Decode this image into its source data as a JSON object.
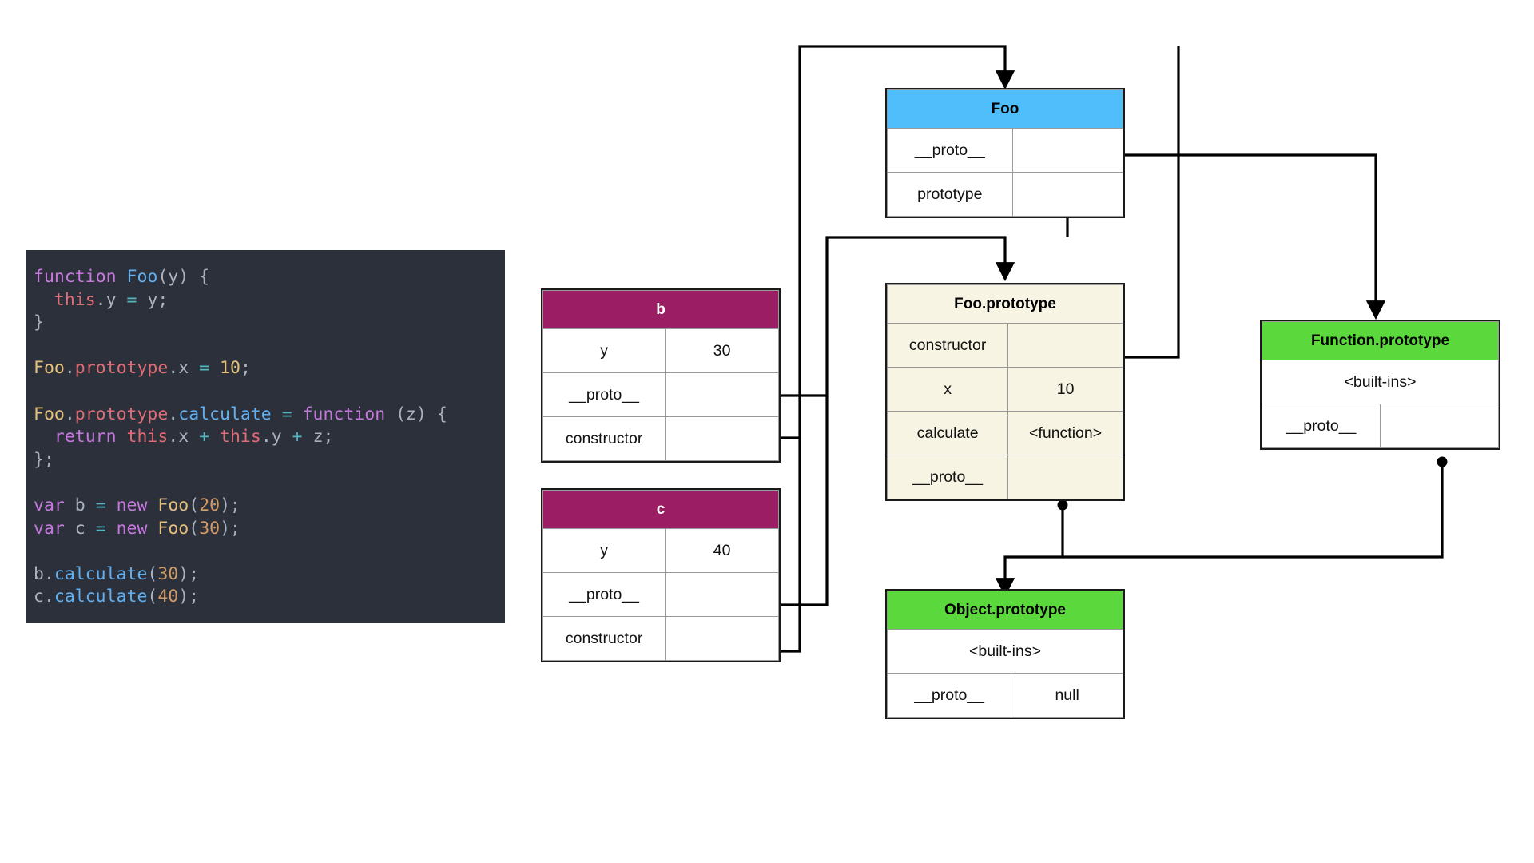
{
  "code": {
    "language": "javascript",
    "lines": [
      [
        {
          "t": "function ",
          "c": "kw"
        },
        {
          "t": "Foo",
          "c": "fn"
        },
        {
          "t": "(y) {",
          "c": "pl"
        }
      ],
      [
        {
          "t": "  ",
          "c": "pl"
        },
        {
          "t": "this",
          "c": "this"
        },
        {
          "t": ".y ",
          "c": "pl"
        },
        {
          "t": "=",
          "c": "op"
        },
        {
          "t": " y;",
          "c": "pl"
        }
      ],
      [
        {
          "t": "}",
          "c": "pl"
        }
      ],
      [
        {
          "t": "",
          "c": "pl"
        }
      ],
      [
        {
          "t": "Foo",
          "c": "var"
        },
        {
          "t": ".",
          "c": "pl"
        },
        {
          "t": "prototype",
          "c": "prop"
        },
        {
          "t": ".x ",
          "c": "pl"
        },
        {
          "t": "=",
          "c": "op"
        },
        {
          "t": " ",
          "c": "pl"
        },
        {
          "t": "10",
          "c": "var"
        },
        {
          "t": ";",
          "c": "pl"
        }
      ],
      [
        {
          "t": "",
          "c": "pl"
        }
      ],
      [
        {
          "t": "Foo",
          "c": "var"
        },
        {
          "t": ".",
          "c": "pl"
        },
        {
          "t": "prototype",
          "c": "prop"
        },
        {
          "t": ".",
          "c": "pl"
        },
        {
          "t": "calculate",
          "c": "fn"
        },
        {
          "t": " ",
          "c": "pl"
        },
        {
          "t": "=",
          "c": "op"
        },
        {
          "t": " ",
          "c": "pl"
        },
        {
          "t": "function",
          "c": "kw"
        },
        {
          "t": " (z) {",
          "c": "pl"
        }
      ],
      [
        {
          "t": "  ",
          "c": "pl"
        },
        {
          "t": "return",
          "c": "kw"
        },
        {
          "t": " ",
          "c": "pl"
        },
        {
          "t": "this",
          "c": "this"
        },
        {
          "t": ".x ",
          "c": "pl"
        },
        {
          "t": "+",
          "c": "op"
        },
        {
          "t": " ",
          "c": "pl"
        },
        {
          "t": "this",
          "c": "this"
        },
        {
          "t": ".y ",
          "c": "pl"
        },
        {
          "t": "+",
          "c": "op"
        },
        {
          "t": " z;",
          "c": "pl"
        }
      ],
      [
        {
          "t": "};",
          "c": "pl"
        }
      ],
      [
        {
          "t": "",
          "c": "pl"
        }
      ],
      [
        {
          "t": "var",
          "c": "kw"
        },
        {
          "t": " b ",
          "c": "pl"
        },
        {
          "t": "=",
          "c": "op"
        },
        {
          "t": " ",
          "c": "pl"
        },
        {
          "t": "new",
          "c": "kw"
        },
        {
          "t": " ",
          "c": "pl"
        },
        {
          "t": "Foo",
          "c": "var"
        },
        {
          "t": "(",
          "c": "pl"
        },
        {
          "t": "20",
          "c": "num"
        },
        {
          "t": ");",
          "c": "pl"
        }
      ],
      [
        {
          "t": "var",
          "c": "kw"
        },
        {
          "t": " c ",
          "c": "pl"
        },
        {
          "t": "=",
          "c": "op"
        },
        {
          "t": " ",
          "c": "pl"
        },
        {
          "t": "new",
          "c": "kw"
        },
        {
          "t": " ",
          "c": "pl"
        },
        {
          "t": "Foo",
          "c": "var"
        },
        {
          "t": "(",
          "c": "pl"
        },
        {
          "t": "30",
          "c": "num"
        },
        {
          "t": ");",
          "c": "pl"
        }
      ],
      [
        {
          "t": "",
          "c": "pl"
        }
      ],
      [
        {
          "t": "b.",
          "c": "pl"
        },
        {
          "t": "calculate",
          "c": "fn"
        },
        {
          "t": "(",
          "c": "pl"
        },
        {
          "t": "30",
          "c": "num"
        },
        {
          "t": ");",
          "c": "pl"
        }
      ],
      [
        {
          "t": "c.",
          "c": "pl"
        },
        {
          "t": "calculate",
          "c": "fn"
        },
        {
          "t": "(",
          "c": "pl"
        },
        {
          "t": "40",
          "c": "num"
        },
        {
          "t": ");",
          "c": "pl"
        }
      ]
    ]
  },
  "colors": {
    "code_background": "#2b303b",
    "header_magenta": "#9b1d64",
    "header_blue": "#4fbefb",
    "header_orange": "#f98e05",
    "header_green": "#5bd83b",
    "row_cream": "#f7f4e4",
    "wire": "#000000",
    "border": "#9a9a9a",
    "outer_border": "#1a1a1a"
  },
  "objects": {
    "b": {
      "title": "b",
      "rows": [
        {
          "key": "y",
          "value": "30"
        },
        {
          "key": "__proto__",
          "value": ""
        },
        {
          "key": "constructor",
          "value": ""
        }
      ]
    },
    "c": {
      "title": "c",
      "rows": [
        {
          "key": "y",
          "value": "40"
        },
        {
          "key": "__proto__",
          "value": ""
        },
        {
          "key": "constructor",
          "value": ""
        }
      ]
    },
    "foo": {
      "title": "Foo",
      "rows": [
        {
          "key": "__proto__",
          "value": ""
        },
        {
          "key": "prototype",
          "value": ""
        }
      ]
    },
    "foo_prototype": {
      "title": "Foo.prototype",
      "rows": [
        {
          "key": "constructor",
          "value": ""
        },
        {
          "key": "x",
          "value": "10"
        },
        {
          "key": "calculate",
          "value": "<function>"
        },
        {
          "key": "__proto__",
          "value": ""
        }
      ]
    },
    "function_prototype": {
      "title": "Function.prototype",
      "builtins": "<built-ins>",
      "rows": [
        {
          "key": "__proto__",
          "value": ""
        }
      ]
    },
    "object_prototype": {
      "title": "Object.prototype",
      "builtins": "<built-ins>",
      "rows": [
        {
          "key": "__proto__",
          "value": "null"
        }
      ]
    }
  },
  "connections": [
    {
      "from": "b.__proto__",
      "to": "Foo.prototype"
    },
    {
      "from": "b.constructor",
      "to": "Foo"
    },
    {
      "from": "c.__proto__",
      "to": "Foo.prototype"
    },
    {
      "from": "c.constructor",
      "to": "Foo"
    },
    {
      "from": "Foo.__proto__",
      "to": "Function.prototype"
    },
    {
      "from": "Foo.prototype",
      "to": "Foo.prototype"
    },
    {
      "from": "Foo.prototype.constructor",
      "to": "Foo"
    },
    {
      "from": "Foo.prototype.__proto__",
      "to": "Object.prototype"
    },
    {
      "from": "Function.prototype.__proto__",
      "to": "Object.prototype"
    }
  ]
}
